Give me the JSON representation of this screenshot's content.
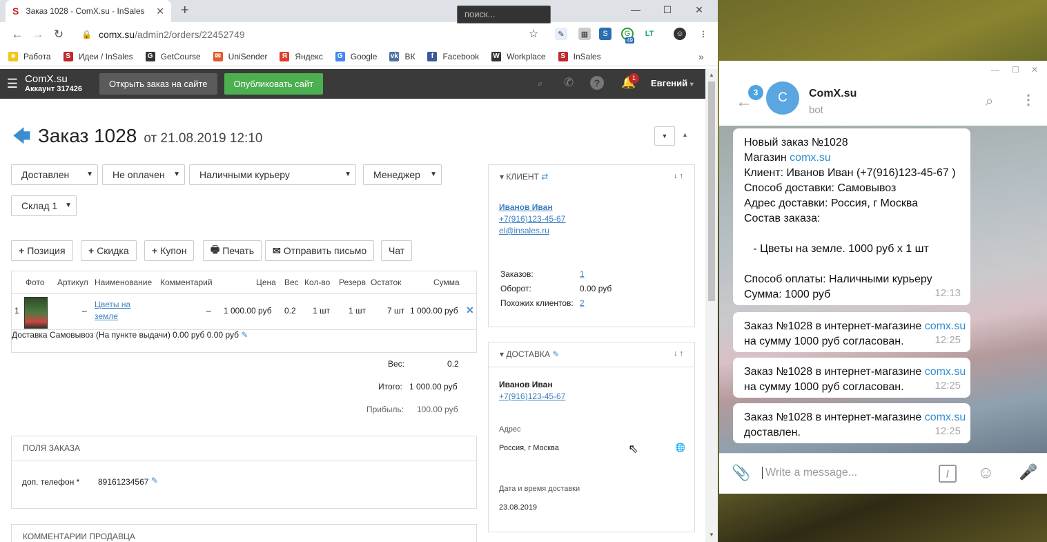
{
  "browser": {
    "tab_title": "Заказ 1028 - ComX.su - InSales",
    "url_host": "comx.su",
    "url_path": "/admin2/orders/22452749",
    "ext_badge": "49",
    "bookmarks": [
      {
        "label": "Работа",
        "icon_color": "#f5c518"
      },
      {
        "label": "Идеи / InSales",
        "icon_color": "#c0282e"
      },
      {
        "label": "GetCourse",
        "icon_color": "#333333"
      },
      {
        "label": "UniSender",
        "icon_color": "#e05a2a"
      },
      {
        "label": "Яндекс",
        "icon_color": "#e33a2a"
      },
      {
        "label": "Google",
        "icon_color": "#4285f4"
      },
      {
        "label": "ВК",
        "icon_color": "#4c75a3"
      },
      {
        "label": "Facebook",
        "icon_color": "#3b5998"
      },
      {
        "label": "Workplace",
        "icon_color": "#333333"
      },
      {
        "label": "InSales",
        "icon_color": "#c0282e"
      }
    ]
  },
  "header": {
    "brand": "ComX.su",
    "account": "Аккаунт 317426",
    "btn_open_site": "Открыть заказ на сайте",
    "btn_publish": "Опубликовать сайт",
    "search_placeholder": "поиск...",
    "notif_count": "1",
    "user": "Евгений"
  },
  "order": {
    "title": "Заказ 1028",
    "date": "от 21.08.2019 12:10",
    "status": "Доставлен",
    "payment_status": "Не оплачен",
    "payment_method": "Наличными курьеру",
    "manager": "Менеджер",
    "warehouse": "Склад 1",
    "actions": {
      "position": "Позиция",
      "discount": "Скидка",
      "coupon": "Купон",
      "print": "Печать",
      "send_mail": "Отправить письмо",
      "chat": "Чат"
    },
    "columns": {
      "photo": "Фото",
      "sku": "Артикул",
      "name": "Наименование",
      "comment": "Комментарий",
      "price": "Цена",
      "weight": "Вес",
      "qty": "Кол-во",
      "reserve": "Резерв",
      "stock": "Остаток",
      "sum": "Сумма"
    },
    "item": {
      "num": "1",
      "sku": "–",
      "name_line1": "Цветы на",
      "name_line2": "земле",
      "comment": "–",
      "price": "1 000.00 руб",
      "weight": "0.2",
      "qty": "1 шт",
      "reserve": "1 шт",
      "stock": "7 шт",
      "sum": "1 000.00 руб"
    },
    "delivery_row": {
      "label": "Доставка",
      "name": "Самовывоз (На пункте выдачи)",
      "price": "0.00 руб",
      "sum": "0.00 руб"
    },
    "totals": {
      "weight_label": "Вес:",
      "weight": "0.2",
      "total_label": "Итого:",
      "total": "1 000.00 руб",
      "profit_label": "Прибыль:",
      "profit": "100.00 руб"
    },
    "fields_title": "ПОЛЯ ЗАКАЗА",
    "extra_phone_label": "доп. телефон *",
    "extra_phone": "89161234567",
    "seller_comments_title": "КОММЕНТАРИИ ПРОДАВЦА"
  },
  "client": {
    "title": "КЛИЕНТ",
    "name": "Иванов Иван",
    "phone": "+7(916)123-45-67",
    "email": "el@insales.ru",
    "orders_label": "Заказов:",
    "orders": "1",
    "turnover_label": "Оборот:",
    "turnover": "0.00 руб",
    "similar_label": "Похожих клиентов:",
    "similar": "2"
  },
  "delivery": {
    "title": "ДОСТАВКА",
    "name": "Иванов Иван",
    "phone": "+7(916)123-45-67",
    "address_label": "Адрес",
    "address": "Россия, г Москва",
    "date_label": "Дата и время доставки",
    "date": "23.08.2019"
  },
  "telegram": {
    "unread": "3",
    "avatar_letter": "C",
    "chat_name": "ComX.su",
    "chat_sub": "bot",
    "messages": [
      {
        "lines": [
          "Новый заказ №1028",
          "Магазин ",
          "Клиент: Иванов Иван (+7(916)123-45-67 )",
          "Способ доставки: Самовывоз",
          "Адрес доставки: Россия, г Москва",
          "Состав заказа:",
          "",
          "   - Цветы на земле. 1000 руб х 1 шт",
          "",
          "Способ оплаты: Наличными курьеру",
          "Сумма: 1000 руб"
        ],
        "link": "comx.su",
        "time": "12:13"
      },
      {
        "pre": "Заказ №1028 в интернет-магазине ",
        "link": "comx.su",
        "post": "на сумму 1000 руб согласован.",
        "time": "12:25"
      },
      {
        "pre": "Заказ №1028 в интернет-магазине ",
        "link": "comx.su",
        "post": "на сумму 1000 руб согласован.",
        "time": "12:25"
      },
      {
        "pre": "Заказ №1028 в интернет-магазине ",
        "link": "comx.su",
        "post": "доставлен.",
        "time": "12:25"
      }
    ],
    "input_placeholder": "Write a message..."
  }
}
